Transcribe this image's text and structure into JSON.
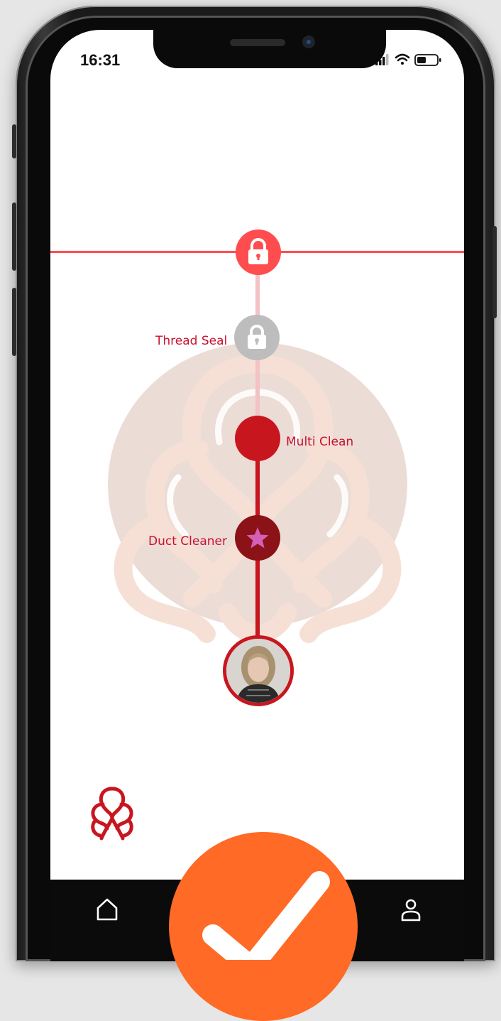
{
  "status_bar": {
    "time": "16:31"
  },
  "path": {
    "nodes": [
      {
        "id": "locked-top",
        "label": "",
        "state": "locked-active",
        "icon": "lock-icon",
        "color": "#ff4d4f"
      },
      {
        "id": "thread-seal",
        "label": "Thread Seal",
        "state": "locked",
        "icon": "lock-icon",
        "color": "#bdbdbd"
      },
      {
        "id": "multi-clean",
        "label": "Multi Clean",
        "state": "available",
        "icon": "",
        "color": "#c8161f"
      },
      {
        "id": "duct-cleaner",
        "label": "Duct Cleaner",
        "state": "completed",
        "icon": "star-icon",
        "color": "#8b1217"
      }
    ]
  },
  "nav": {
    "items": [
      {
        "id": "home",
        "icon": "home-icon"
      },
      {
        "id": "profile",
        "icon": "user-icon"
      }
    ]
  },
  "fab": {
    "icon": "check-icon",
    "color": "#ff6a26"
  },
  "colors": {
    "accent": "#ff4d4f",
    "primary": "#c8161f",
    "dark": "#8b1217",
    "locked": "#bdbdbd",
    "watermark": "#f4d8ce"
  }
}
